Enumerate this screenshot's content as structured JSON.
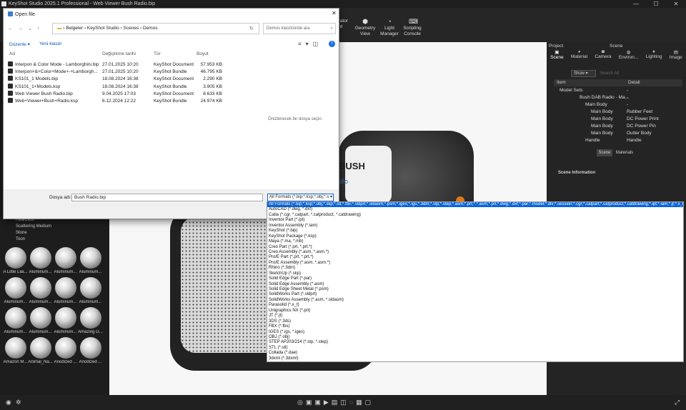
{
  "app": {
    "title": "KeyShot Studio 2025.1 Professional - Web Viewer Bush Radio.bip",
    "window_controls": [
      "—",
      "☐",
      "✕"
    ]
  },
  "toolbar": {
    "buttons": [
      {
        "label": "Configurator Wizard",
        "label_visible": "urator\nard",
        "icon": "wizard-icon"
      },
      {
        "label": "Geometry View",
        "icon": "geometry-icon"
      },
      {
        "label": "Light Manager",
        "icon": "light-manager-icon"
      },
      {
        "label": "Scripting Console",
        "icon": "scripting-icon"
      }
    ]
  },
  "dialog": {
    "title": "Open file",
    "breadcrumb": [
      "Belgeler",
      "KeyShot Studio",
      "Scenes",
      "Demos"
    ],
    "search_placeholder": "Demos klasöründe ara",
    "actions": {
      "organize": "Düzenle ▾",
      "new_folder": "Yeni klasör"
    },
    "columns": {
      "name": "Ad",
      "date": "Değiştirme tarihi",
      "type": "Tür",
      "size": "Boyut"
    },
    "files": [
      {
        "name": "Interpon & Color Mode - Lamborghini.bip",
        "date": "27.01.2025 10:20",
        "type": "KeyShot Document",
        "size": "57.953 KB"
      },
      {
        "name": "Interpon+&+Color+Mode+-+Lamborgh...",
        "date": "27.01.2025 10:20",
        "type": "KeyShot Bundle",
        "size": "46.795 KB"
      },
      {
        "name": "KS101_1 Models.bip",
        "date": "18.08.2024 16:38",
        "type": "KeyShot Document",
        "size": "2.290 KB"
      },
      {
        "name": "KS101_1+Models.ksp",
        "date": "18.08.2024 16:38",
        "type": "KeyShot Bundle",
        "size": "3.905 KB"
      },
      {
        "name": "Web Viewer Bush Radio.bip",
        "date": "9.04.2025 17:03",
        "type": "KeyShot Document",
        "size": "8.633 KB"
      },
      {
        "name": "Web+Viewer+Bush+Radio.ksp",
        "date": "6.12.2024 12:22",
        "type": "KeyShot Bundle",
        "size": "24.974 KB"
      }
    ],
    "preview_hint": "Önizlenecek bir dosya seçin.",
    "filename_label": "Dosya adı:",
    "filename_value": "Bush Radio.bip",
    "filter_value": "All Formats (*.bip;*.ksp;*.obj;*.s",
    "filter_options": [
      "All Formats (*.bip;*.ksp;*.obj;*.skp;*.stl;*.fbx;*.sldprt;*.sldasm;*.psm;*.iges;*.igs;*.3dm;*.stp;*.step;*.asm;*.prt;*.*.asm;*.prt;*.dwg;*.dxf;*.par;*.model;*.dlv;*.session;*.cgr;*.catpart;*.catproduct;*.catdrawing;*.ipt;*.iam;*.jt;*.x_t;*",
      "AutoCAD (*.dwg, *.dxf)",
      "Catia (*.cgr, *.catpart, *.catproduct, *.catdrawing)",
      "Inventor Part (*.ipt)",
      "Inventor Assembly (*.iam)",
      "KeyShot (*.bip)",
      "KeyShot Package (*.ksp)",
      "Maya (*.ma, *.mb)",
      "Creo Part (*.prt, *.prt.*)",
      "Creo Assembly (*.asm, *.asm.*)",
      "Pro/E Part (*.prt, *.prt.*)",
      "Pro/E Assembly (*.asm, *.asm.*)",
      "Rhino (*.3dm)",
      "SketchUp (*.skp)",
      "Solid Edge Part (*.par)",
      "Solid Edge Assembly (*.asm)",
      "Solid Edge Sheet Metal (*.psm)",
      "SolidWorks Part (*.sldprt)",
      "SolidWorks Assembly (*.asm, *.sldasm)",
      "Parasolid (*.x_t)",
      "Unigraphics NX (*.prt)",
      "JT (*.jt)",
      "3DS (*.3ds)",
      "FBX (*.fbx)",
      "IGES (*.igs, *.iges)",
      "OBJ (*.obj)",
      "STEP AP203/214 (*.stp, *.step)",
      "STL (*.stl)",
      "Collada (*.dae)",
      "3dxml (*.3dxml)"
    ]
  },
  "viewport": {
    "brand": "BUSH",
    "sub": "dio"
  },
  "library": {
    "folders": [
      "RealCloth",
      "Scattering Medium",
      "Stone",
      "Toon"
    ],
    "materials": [
      "A Little Lila...",
      "Aluminum...",
      "Aluminum...",
      "Aluminum...",
      "Aluminum...",
      "Aluminum...",
      "Aluminum...",
      "Aluminum...",
      "Aluminum...",
      "Aluminum...",
      "Aluminum...",
      "Amazing G...",
      "Amazon M...",
      "Animal_Na...",
      "Anodized ...",
      "Anodized ..."
    ]
  },
  "right": {
    "header": {
      "project": "Project",
      "scene": "Scene"
    },
    "tabs": [
      "Scene",
      "Material",
      "Camera",
      "Environ...",
      "Lighting",
      "Image"
    ],
    "show": "Show",
    "search_placeholder": "Search All",
    "columns": {
      "item": "Item",
      "detail": "Detail"
    },
    "tree": [
      {
        "item": "Model Sets",
        "detail": "-",
        "indent": 0
      },
      {
        "item": "Bush DAB Radio - Ma...",
        "detail": "-",
        "indent": 1
      },
      {
        "item": "Main Body",
        "detail": "-",
        "indent": 2
      },
      {
        "item": "Main Body",
        "detail": "Rubber Feet",
        "indent": 3
      },
      {
        "item": "Main Body",
        "detail": "DC Power Print",
        "indent": 3
      },
      {
        "item": "Main Body",
        "detail": "DC Power Pin",
        "indent": 3
      },
      {
        "item": "Main Body",
        "detail": "Outter Body",
        "indent": 3
      },
      {
        "item": "Handle",
        "detail": "Handle",
        "indent": 2
      }
    ],
    "subtabs": [
      "Scene",
      "Materials"
    ],
    "scene_info": "Scene Information"
  }
}
